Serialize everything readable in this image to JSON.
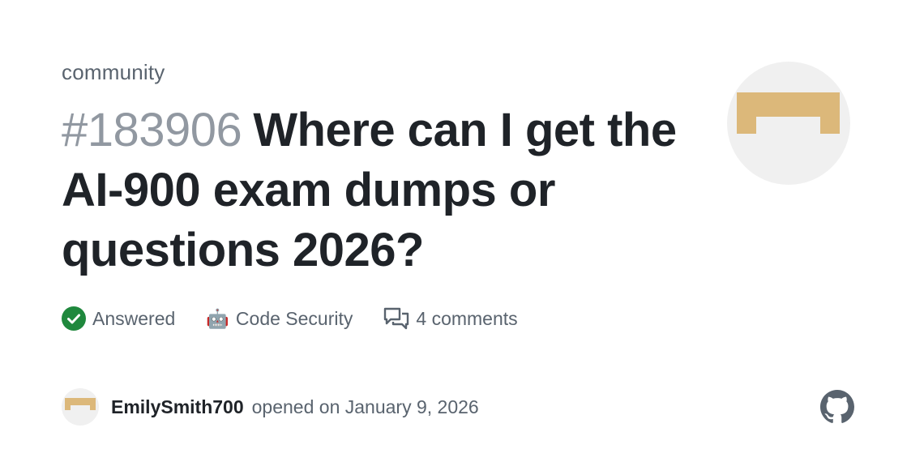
{
  "repo": {
    "name": "community",
    "avatar_icon": "identicon-avatar",
    "avatar_color": "#dcb87a"
  },
  "issue": {
    "number": "#183906",
    "title": "Where can I get the AI-900 exam dumps or questions 2026?"
  },
  "meta": {
    "status_label": "Answered",
    "status_icon": "check-circle-icon",
    "status_color": "#1f883d",
    "category_emoji": "🤖",
    "category_label": "Code Security",
    "comments_icon": "comment-discussion-icon",
    "comments_label": "4 comments"
  },
  "author": {
    "username": "EmilySmith700",
    "opened_text": "opened on January 9, 2026",
    "avatar_icon": "identicon-avatar"
  },
  "brand": {
    "logo_icon": "github-logo-icon",
    "logo_color": "#59636e"
  }
}
